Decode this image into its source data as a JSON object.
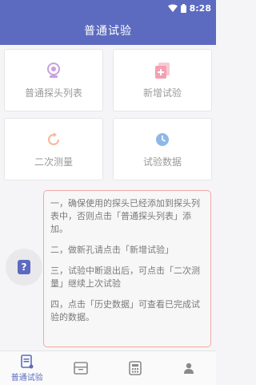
{
  "status_bar": {
    "time": "8:28",
    "wifi_icon": "wifi-icon",
    "battery_icon": "battery-icon"
  },
  "app_bar": {
    "title": "普通试验"
  },
  "cards": [
    {
      "label": "普通探头列表",
      "icon": "probe-icon",
      "color": "#c9a0dc"
    },
    {
      "label": "新增试验",
      "icon": "add-document-icon",
      "color": "#f4a0b0"
    },
    {
      "label": "二次测量",
      "icon": "refresh-icon",
      "color": "#f6b896"
    },
    {
      "label": "试验数据",
      "icon": "clock-icon",
      "color": "#8fb8e8"
    }
  ],
  "help": {
    "items": [
      "一，确保使用的探头已经添加到探头列表中，否则点击「普通探头列表」添加。",
      "二，做新孔请点击「新增试验」",
      "三，试验中断退出后，可点击「二次测量」继续上次试验",
      "四，点击「历史数据」可查看已完成试验的数据。"
    ],
    "fab_icon": "help-icon",
    "fab_glyph": "?"
  },
  "bottom_nav": [
    {
      "label": "普通试验",
      "icon": "test-list-icon",
      "active": true
    },
    {
      "label": "",
      "icon": "archive-icon",
      "active": false
    },
    {
      "label": "",
      "icon": "calculator-icon",
      "active": false
    },
    {
      "label": "",
      "icon": "user-icon",
      "active": false
    }
  ],
  "colors": {
    "primary": "#5c6bc0",
    "inactive_icon": "#8a8a8a",
    "border_red": "#f0a8a8"
  }
}
